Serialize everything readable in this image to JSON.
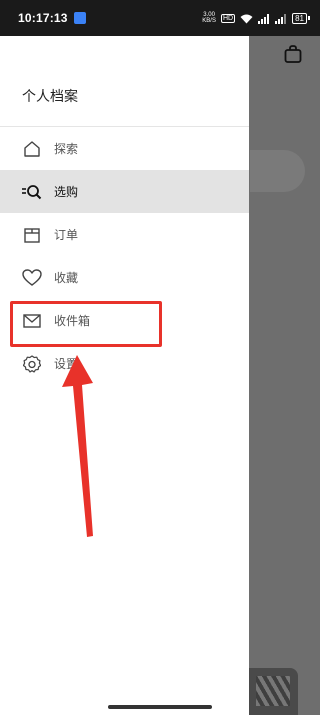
{
  "status_bar": {
    "time": "10:17:13",
    "network_speed_value": "3.00",
    "network_speed_unit": "KB/S",
    "hd_label": "HD",
    "battery": "81"
  },
  "drawer": {
    "title": "个人档案",
    "items": [
      {
        "label": "探索",
        "icon": "home-icon",
        "active": false
      },
      {
        "label": "选购",
        "icon": "search-list-icon",
        "active": true
      },
      {
        "label": "订单",
        "icon": "box-icon",
        "active": false
      },
      {
        "label": "收藏",
        "icon": "heart-icon",
        "active": false
      },
      {
        "label": "收件箱",
        "icon": "mail-icon",
        "active": false
      },
      {
        "label": "设置",
        "icon": "gear-icon",
        "active": false
      }
    ]
  },
  "annotation": {
    "highlight_color": "#e8322a",
    "highlighted_item": "设置"
  },
  "colors": {
    "drawer_bg": "#ffffff",
    "active_item_bg": "#e3e3e3",
    "overlay_bg": "#6e6e6e"
  }
}
